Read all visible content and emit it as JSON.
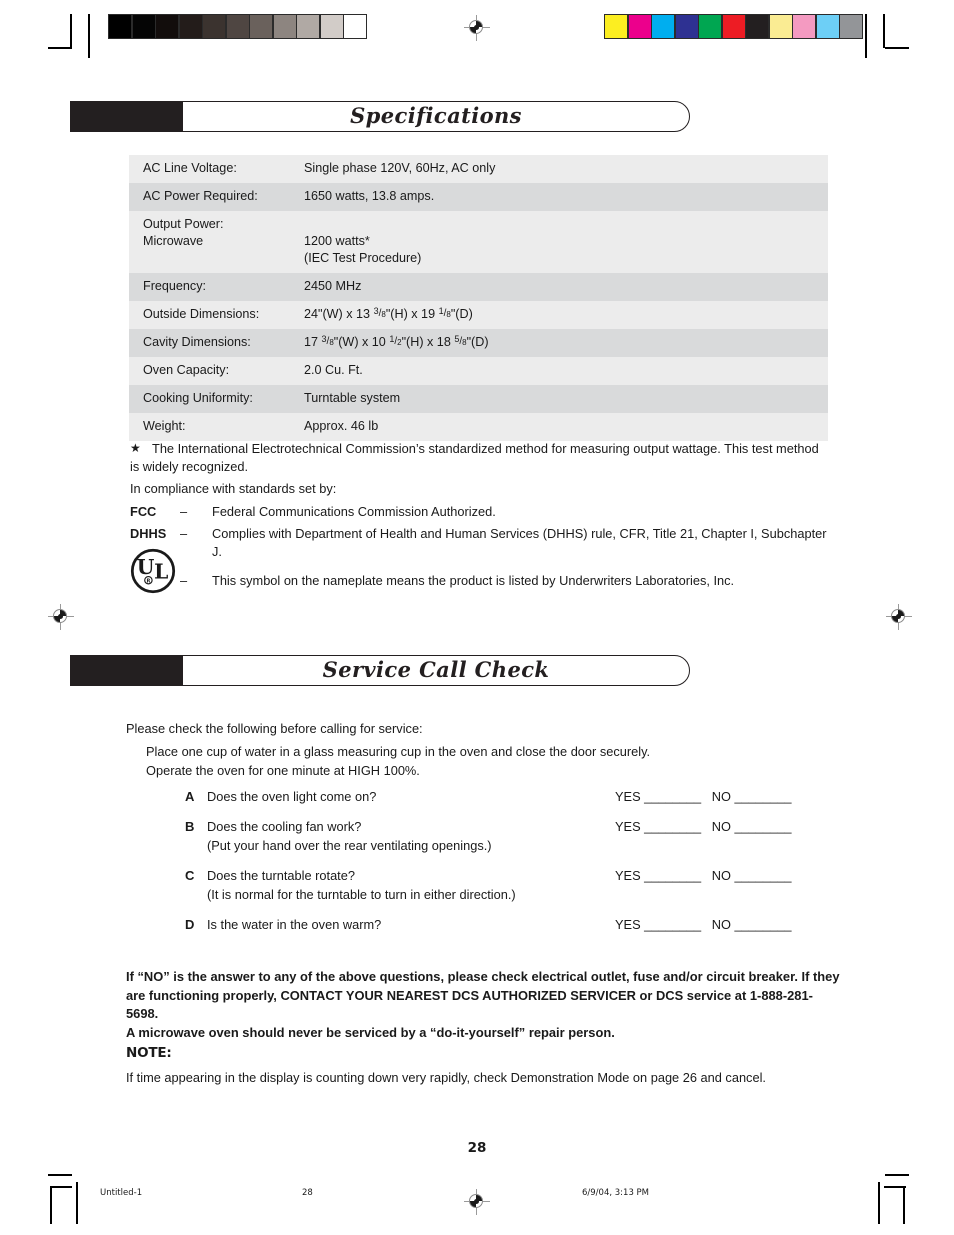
{
  "prepress": {
    "grayscale_swatches": [
      "#000000",
      "#050505",
      "#120d0c",
      "#231c1a",
      "#3b332f",
      "#4f4642",
      "#6a615c",
      "#8d8580",
      "#b0a9a4",
      "#d2ccc8",
      "#ffffff"
    ],
    "color_swatches": [
      "#fcee21",
      "#ec008c",
      "#00aeef",
      "#2e3192",
      "#00a651",
      "#ed1c24",
      "#231f20",
      "#faec93",
      "#f49ac1",
      "#6dcff6",
      "#939598"
    ],
    "registration_mark_name": "registration-target"
  },
  "sections": [
    {
      "id": "specifications",
      "banner_title": "Specifications"
    },
    {
      "id": "service-call-check",
      "banner_title": "Service Call Check"
    }
  ],
  "spec_table": {
    "rows": [
      {
        "label_lines": [
          "AC Line Voltage:"
        ],
        "value_lines": [
          "Single phase 120V, 60Hz, AC only"
        ]
      },
      {
        "label_lines": [
          "AC Power Required:"
        ],
        "value_lines": [
          "1650 watts, 13.8 amps."
        ]
      },
      {
        "label_lines": [
          "Output Power:",
          "Microwave"
        ],
        "value_lines": [
          "",
          "1200 watts*",
          "(IEC Test Procedure)"
        ]
      },
      {
        "label_lines": [
          "Frequency:"
        ],
        "value_lines": [
          "2450 MHz"
        ]
      },
      {
        "label_lines": [
          "Outside Dimensions:"
        ],
        "value_html": "24\"(W) x 13 <span class=\"frac\"><span class=\"num\">3</span><span class=\"sl\">/</span><span class=\"den\">8</span></span>\"(H) x 19 <span class=\"frac\"><span class=\"num\">1</span><span class=\"sl\">/</span><span class=\"den\">8</span></span>\"(D)",
        "value_plain": "24\"(W) x 13 3/8\"(H) x 19 1/8\"(D)"
      },
      {
        "label_lines": [
          "Cavity Dimensions:"
        ],
        "value_html": "17 <span class=\"frac\"><span class=\"num\">3</span><span class=\"sl\">/</span><span class=\"den\">8</span></span>\"(W) x 10 <span class=\"frac\"><span class=\"num\">1</span><span class=\"sl\">/</span><span class=\"den\">2</span></span>\"(H) x 18 <span class=\"frac\"><span class=\"num\">5</span><span class=\"sl\">/</span><span class=\"den\">8</span></span>\"(D)",
        "value_plain": "17 3/8\"(W) x 10 1/2\"(H) x 18 5/8\"(D)"
      },
      {
        "label_lines": [
          "Oven Capacity:"
        ],
        "value_lines": [
          "2.0 Cu. Ft."
        ]
      },
      {
        "label_lines": [
          "Cooking Uniformity:"
        ],
        "value_lines": [
          "Turntable system"
        ]
      },
      {
        "label_lines": [
          "Weight:"
        ],
        "value_lines": [
          "Approx. 46 lb"
        ]
      }
    ]
  },
  "footnote": {
    "marker": "★",
    "text": "The International Electrotechnical Commission’s standardized method for measuring output wattage. This test method is widely recognized."
  },
  "compliance": {
    "lead": "In compliance with standards set by:",
    "items": [
      {
        "term": "FCC",
        "dash": "–",
        "text": "Federal Communications Commission Authorized."
      },
      {
        "term": "DHHS",
        "dash": "–",
        "text": "Complies with Department of Health and Human Services (DHHS) rule, CFR, Title 21, Chapter I, Subchapter J."
      },
      {
        "term": "",
        "dash": "–",
        "text": "This symbol on the nameplate means the product is listed by Underwriters Laboratories, Inc."
      }
    ],
    "ul_logo": {
      "letters": "UL",
      "registered": "®"
    }
  },
  "service_call": {
    "lead": "Please check the following before calling for service:",
    "instructions": [
      "Place one cup of water in a glass measuring cup in the oven and close the door securely.",
      "Operate the oven for one minute at HIGH 100%."
    ],
    "answer_labels": {
      "yes": "YES",
      "no": "NO",
      "blank": "________"
    },
    "questions": [
      {
        "letter": "A",
        "text": "Does the oven light come on?",
        "sub": "",
        "answer": "YES ________   NO ________"
      },
      {
        "letter": "B",
        "text": "Does the cooling fan work?",
        "sub": "(Put your hand over the rear ventilating openings.)",
        "answer": "YES ________   NO ________"
      },
      {
        "letter": "C",
        "text": "Does the turntable rotate?",
        "sub": "(It is normal for the turntable to turn in either direction.)",
        "answer": "YES ________   NO ________"
      },
      {
        "letter": "D",
        "text": "Is the water in the oven warm?",
        "sub": "",
        "answer": "YES ________   NO ________"
      }
    ],
    "warning": "If “NO” is the answer to any of the above questions, please check electrical outlet, fuse and/or circuit breaker. If they are functioning properly, CONTACT YOUR NEAREST DCS AUTHORIZED SERVICER or DCS service at 1-888-281-5698.",
    "warning_second": "A microwave oven should never be serviced by a “do-it-yourself” repair person.",
    "note_title": "NOTE:",
    "note_body": "If time appearing in the display is counting down very rapidly, check Demonstration Mode on page 26 and cancel."
  },
  "page": {
    "number": "28",
    "footer_filename": "Untitled-1",
    "footer_page": "28",
    "footer_timestamp": "6/9/04, 3:13 PM"
  }
}
